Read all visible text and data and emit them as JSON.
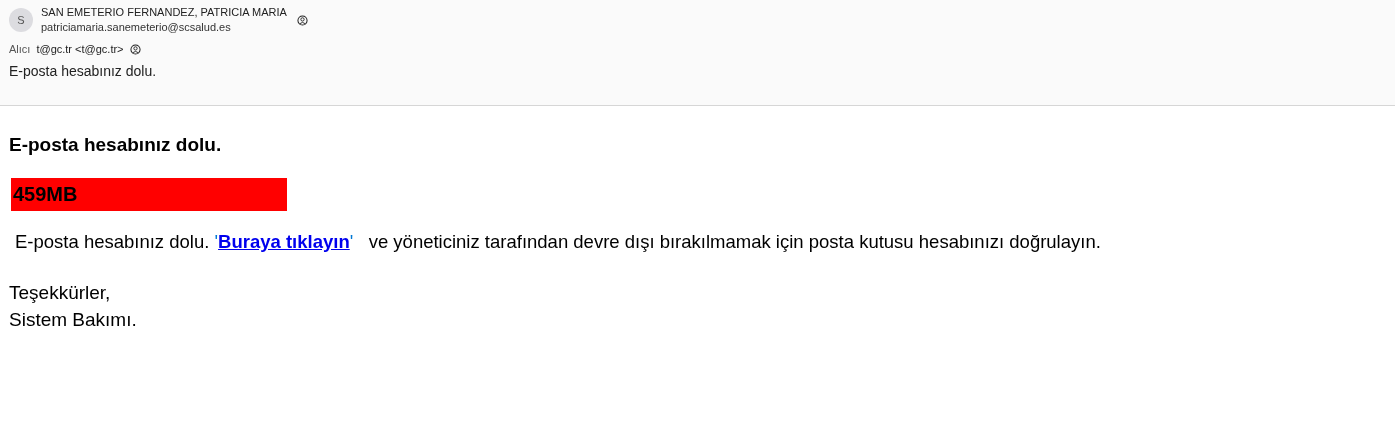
{
  "sender": {
    "avatar_letter": "S",
    "name": "SAN EMETERIO FERNANDEZ, PATRICIA MARIA",
    "email": "patriciamaria.sanemeterio@scsalud.es"
  },
  "recipient": {
    "label": "Alıcı",
    "value": "t@gc.tr <t@gc.tr>"
  },
  "subject": "E-posta hesabınız dolu.",
  "body": {
    "heading": "E-posta hesabınız dolu.",
    "quota_badge": "459MB",
    "paragraph": {
      "before": "E-posta hesabınız dolu. ",
      "open_quote": "'",
      "link": "Buraya tıklayın",
      "close_quote": "'",
      "after": "   ve yöneticiniz tarafından devre dışı bırakılmamak için posta kutusu hesabınızı doğrulayın."
    },
    "closing": [
      "Teşekkürler,",
      "Sistem Bakımı."
    ]
  }
}
